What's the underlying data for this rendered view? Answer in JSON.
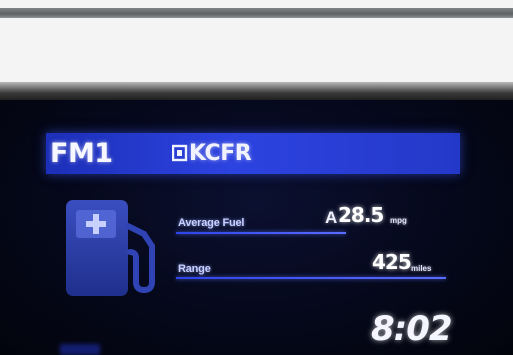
{
  "radio": {
    "band": "FM1",
    "station": "KCFR",
    "station_icon": "rds-icon"
  },
  "trip_info": {
    "average_fuel": {
      "label": "Average Fuel",
      "prefix": "A",
      "value": "28.5",
      "unit": "mpg"
    },
    "range": {
      "label": "Range",
      "value": "425",
      "unit": "miles"
    }
  },
  "clock": {
    "time": "8:02"
  },
  "icons": {
    "fuel": "fuel-pump-icon"
  },
  "colors": {
    "header_bar": "#2d43e0",
    "screen_bg": "#05081a",
    "text": "#ffffff",
    "icon": "#2a3da8"
  }
}
